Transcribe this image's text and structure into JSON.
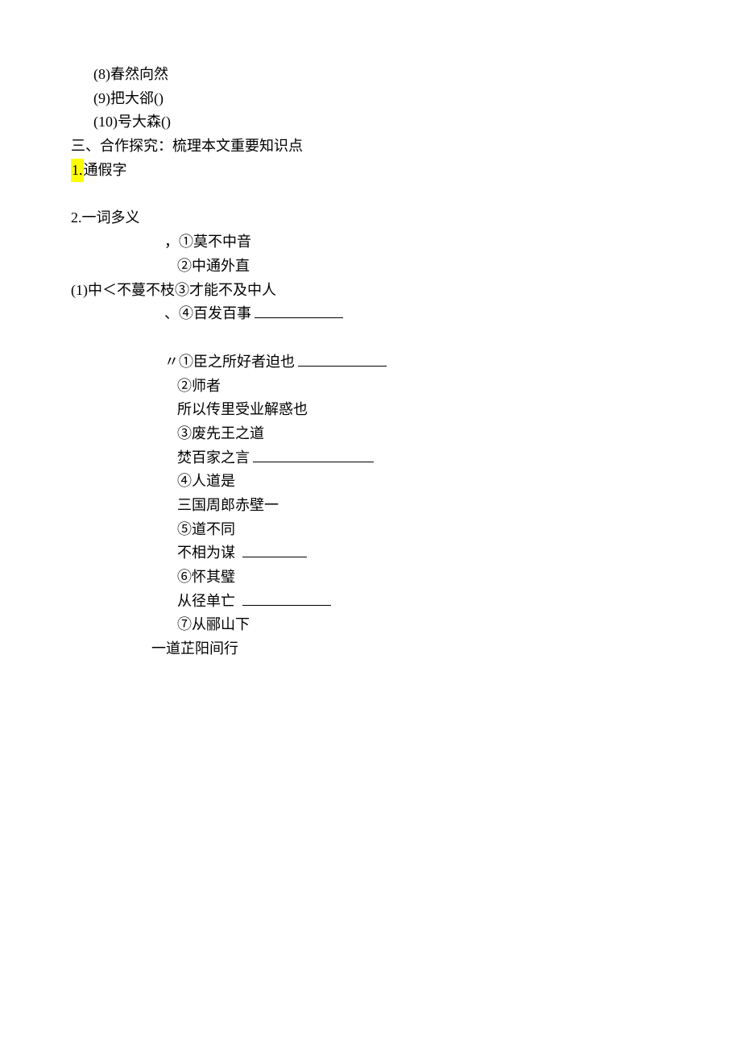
{
  "lines": {
    "l8": "(8)春然向然",
    "l9": "(9)把大郤()",
    "l10": "(10)号大森()",
    "san": "三、合作探究：梳理本文重要知识点",
    "tongjia_prefix": "1.",
    "tongjia": "通假字",
    "duoyi": "2.一词多义",
    "g1_lead": "，①莫不中音",
    "g1_2": "②中通外直",
    "g1_chain": "(1)中＜不蔓不枝③才能不及中人",
    "g1_4_pre": "、④百发百事",
    "g2_1_lead": "〃①臣之所好者迫也",
    "g2_2a": "②师者",
    "g2_2b": "所以传里受业解惑也",
    "g2_3a": "③废先王之道",
    "g2_3b": "焚百家之言",
    "g2_4a": "④人道是",
    "g2_4b": "三国周郎赤壁一",
    "g2_5a": "⑤道不同",
    "g2_5b": "不相为谋",
    "g2_6a": "⑥怀其璧",
    "g2_6b": "从径单亡",
    "g2_7a": "⑦从郦山下",
    "g2_7b": "一道芷阳间行"
  }
}
